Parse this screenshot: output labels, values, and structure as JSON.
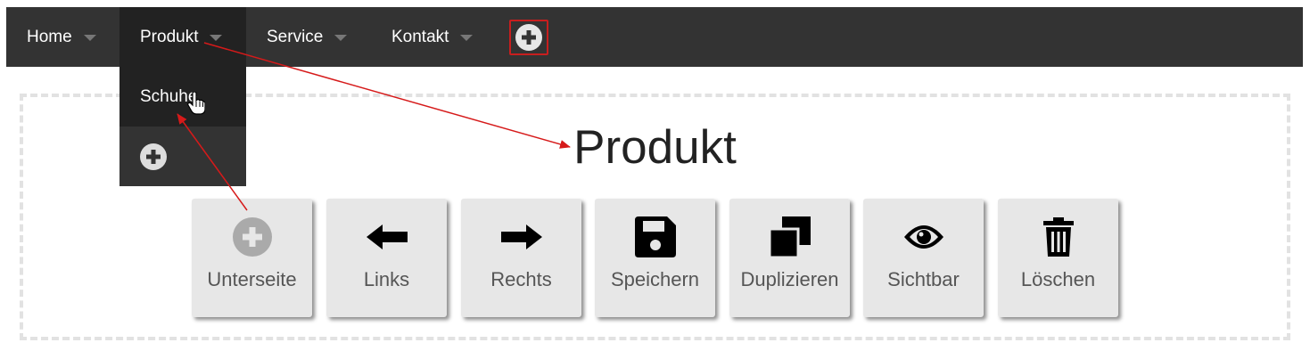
{
  "nav": {
    "items": [
      {
        "label": "Home"
      },
      {
        "label": "Produkt"
      },
      {
        "label": "Service"
      },
      {
        "label": "Kontakt"
      }
    ]
  },
  "dropdown": {
    "items": [
      {
        "label": "Schuhe"
      }
    ]
  },
  "page": {
    "title": "Produkt"
  },
  "toolbar": {
    "buttons": [
      {
        "label": "Unterseite",
        "icon": "plus-circle-icon",
        "disabled": true
      },
      {
        "label": "Links",
        "icon": "arrow-left-icon"
      },
      {
        "label": "Rechts",
        "icon": "arrow-right-icon"
      },
      {
        "label": "Speichern",
        "icon": "save-icon"
      },
      {
        "label": "Duplizieren",
        "icon": "duplicate-icon"
      },
      {
        "label": "Sichtbar",
        "icon": "eye-icon"
      },
      {
        "label": "Löschen",
        "icon": "trash-icon"
      }
    ]
  },
  "colors": {
    "navbar": "#333333",
    "nav_active": "#222222",
    "highlight": "#c81e1e",
    "button_bg": "#e7e7e7"
  }
}
